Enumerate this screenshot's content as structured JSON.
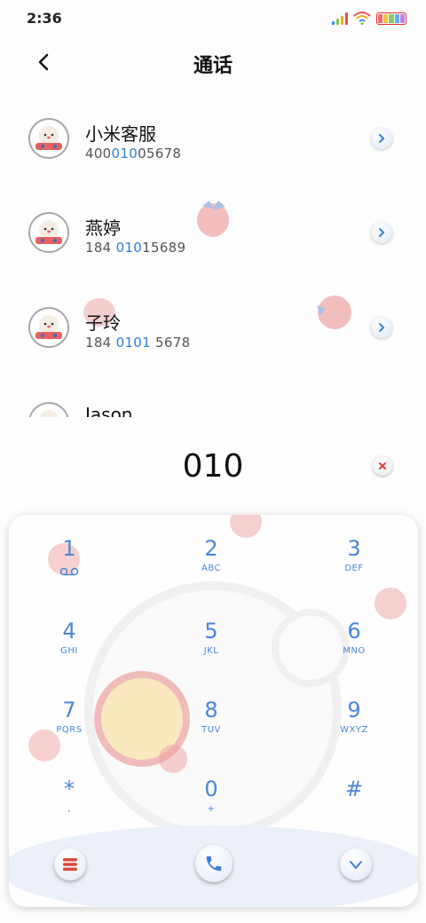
{
  "status_bar": {
    "time": "2:36"
  },
  "header": {
    "title": "通话"
  },
  "contacts": [
    {
      "name": "小米客服",
      "number_parts": [
        "400",
        "010",
        "05678"
      ]
    },
    {
      "name": "燕婷",
      "number_parts": [
        "184 ",
        "010",
        "15689"
      ]
    },
    {
      "name": "子玲",
      "number_parts": [
        "184 ",
        "0101",
        " 5678"
      ]
    },
    {
      "name": "Jason"
    }
  ],
  "dialer": {
    "input_value": "010"
  },
  "keypad": [
    {
      "digit": "1",
      "letters": ""
    },
    {
      "digit": "2",
      "letters": "ABC"
    },
    {
      "digit": "3",
      "letters": "DEF"
    },
    {
      "digit": "4",
      "letters": "GHI"
    },
    {
      "digit": "5",
      "letters": "JKL"
    },
    {
      "digit": "6",
      "letters": "MNO"
    },
    {
      "digit": "7",
      "letters": "PQRS"
    },
    {
      "digit": "8",
      "letters": "TUV"
    },
    {
      "digit": "9",
      "letters": "WXYZ"
    },
    {
      "digit": "*",
      "letters": ","
    },
    {
      "digit": "0",
      "letters": "+"
    },
    {
      "digit": "#",
      "letters": ""
    }
  ],
  "colors": {
    "accent": "#2f7fd6",
    "keypad_text": "#4a86d6",
    "menu_red": "#e0473d",
    "strawberry": "#e86060"
  },
  "icons": {
    "back": "chevron-left-icon",
    "detail": "chevron-right-icon",
    "clear": "close-icon",
    "voicemail": "voicemail-icon",
    "menu": "menu-icon",
    "call": "phone-icon",
    "collapse": "chevron-down-icon"
  }
}
